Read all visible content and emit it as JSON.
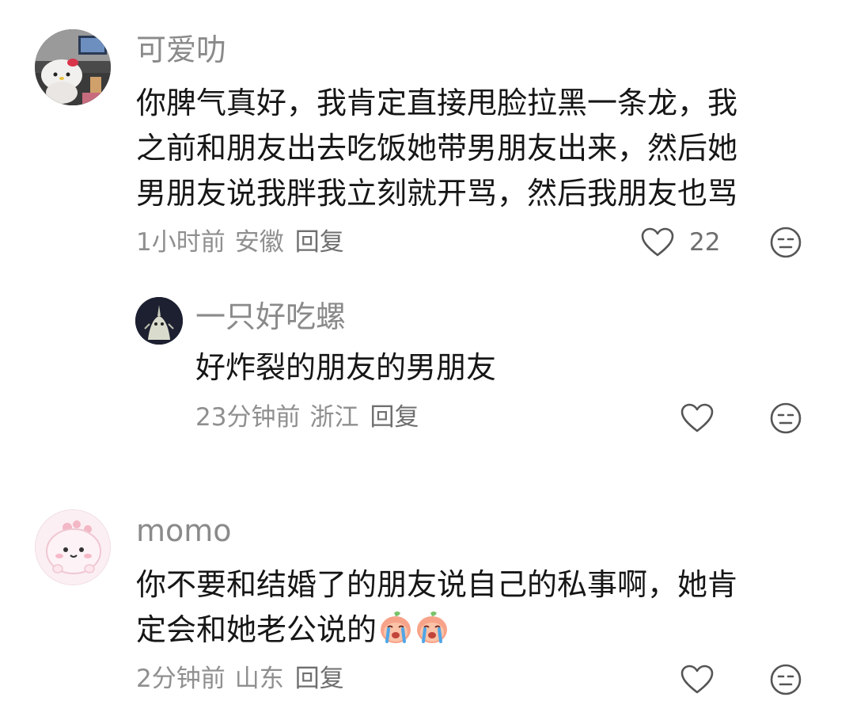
{
  "comments": [
    {
      "user": "可爱叻",
      "lines": [
        "你脾气真好，我肯定直接甩脸拉黑一条龙，我",
        "之前和朋友出去吃饭她带男朋友出来，然后她",
        "男朋友说我胖我立刻就开骂，然后我朋友也骂"
      ],
      "time": "1小时前",
      "location": "安徽",
      "reply_label": "回复",
      "likes": "22",
      "avatar_icon": "hello-kitty-plush-photo",
      "reply": {
        "user": "一只好吃螺",
        "text": "好炸裂的朋友的男朋友",
        "time": "23分钟前",
        "location": "浙江",
        "reply_label": "回复",
        "avatar_icon": "dark-creature-avatar"
      }
    },
    {
      "user": "momo",
      "lines": [
        "你不要和结婚了的朋友说自己的私事啊，她肯",
        "定会和她老公说的"
      ],
      "emojis": [
        "crying-peach-emoji",
        "crying-peach-emoji"
      ],
      "time": "2分钟前",
      "location": "山东",
      "reply_label": "回复",
      "avatar_icon": "pink-blob-character-avatar"
    }
  ],
  "colors": {
    "name": "#8a8a8a",
    "body_text": "#161616",
    "meta_text": "#8f8f8f",
    "icon_stroke": "#555555"
  }
}
